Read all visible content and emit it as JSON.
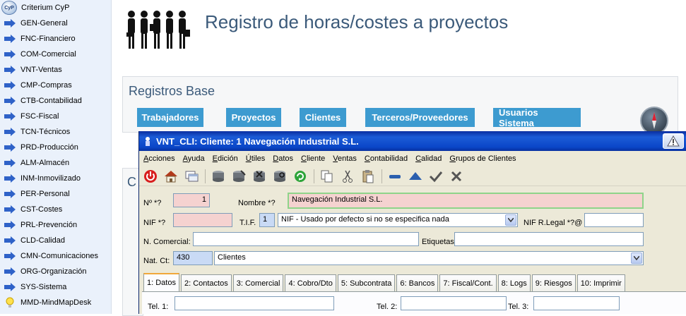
{
  "sidebar": {
    "header": "Criterium CyP",
    "logo_text": "CyP",
    "items": [
      {
        "label": "GEN-General",
        "icon": "arrow-right-icon"
      },
      {
        "label": "FNC-Financiero",
        "icon": "arrow-right-icon"
      },
      {
        "label": "COM-Comercial",
        "icon": "arrow-right-icon"
      },
      {
        "label": "VNT-Ventas",
        "icon": "arrow-right-icon"
      },
      {
        "label": "CMP-Compras",
        "icon": "arrow-right-icon"
      },
      {
        "label": "CTB-Contabilidad",
        "icon": "arrow-right-icon"
      },
      {
        "label": "FSC-Fiscal",
        "icon": "arrow-right-icon"
      },
      {
        "label": "TCN-Técnicos",
        "icon": "arrow-right-icon"
      },
      {
        "label": "PRD-Producción",
        "icon": "arrow-right-icon"
      },
      {
        "label": "ALM-Almacén",
        "icon": "arrow-right-icon"
      },
      {
        "label": "INM-Inmovilizado",
        "icon": "arrow-right-icon"
      },
      {
        "label": "PER-Personal",
        "icon": "arrow-right-icon"
      },
      {
        "label": "CST-Costes",
        "icon": "arrow-right-icon"
      },
      {
        "label": "PRL-Prevención",
        "icon": "arrow-right-icon"
      },
      {
        "label": "CLD-Calidad",
        "icon": "arrow-right-icon"
      },
      {
        "label": "CMN-Comunicaciones",
        "icon": "arrow-right-icon"
      },
      {
        "label": "ORG-Organización",
        "icon": "arrow-right-icon"
      },
      {
        "label": "SYS-Sistema",
        "icon": "arrow-right-icon"
      },
      {
        "label": "MMD-MindMapDesk",
        "icon": "lightbulb-icon"
      }
    ]
  },
  "header": {
    "title": "Registro de horas/costes a proyectos"
  },
  "registros": {
    "title": "Registros Base",
    "buttons": [
      "Trabajadores",
      "Proyectos",
      "Clientes",
      "Terceros/Proveedores",
      "Usuarios Sistema"
    ],
    "second_panel_title": "C"
  },
  "dialog": {
    "title": "VNT_CLI: Cliente: 1 Navegación Industrial S.L.",
    "menu": [
      "Acciones",
      "Ayuda",
      "Edición",
      "Útiles",
      "Datos",
      "Cliente",
      "Ventas",
      "Contabilidad",
      "Calidad",
      "Grupos de Clientes"
    ],
    "toolbar_icons": [
      "power-icon",
      "home-icon",
      "windows-icon",
      "drum-icon",
      "drum-edit-icon",
      "drum-delete-icon",
      "drum-search-icon",
      "refresh-icon",
      "copy-icon",
      "cut-icon",
      "paste-icon",
      "minus-icon",
      "up-triangle-icon",
      "check-icon",
      "close-icon"
    ],
    "form": {
      "num_label": "Nº *?",
      "num_value": "1",
      "nombre_label": "Nombre *?",
      "nombre_value": "Navegación Industrial S.L.",
      "nif_label": "NIF *?",
      "nif_value": "",
      "tif_label": "T.I.F.",
      "tif_value": "1",
      "tif_desc": "NIF - Usado por defecto si no se especifica nada",
      "nif_legal_label": "NIF R.Legal *?@",
      "nif_legal_value": "",
      "ncomercial_label": "N. Comercial:",
      "ncomercial_value": "",
      "etiquetas_label": "Etiquetas",
      "etiquetas_value": "",
      "natct_label": "Nat. Ct:",
      "natct_code": "430",
      "natct_desc": "Clientes"
    },
    "tabs": [
      "1: Datos",
      "2: Contactos",
      "3: Comercial",
      "4: Cobro/Dto",
      "5: Subcontrata",
      "6: Bancos",
      "7: Fiscal/Cont.",
      "8: Logs",
      "9: Riesgos",
      "10: Imprimir"
    ],
    "active_tab": "1: Datos",
    "tel1_label": "Tel. 1:",
    "tel2_label": "Tel. 2:",
    "tel3_label": "Tel. 3:"
  },
  "colors": {
    "accent_button": "#3d9bd0",
    "title_text": "#3b5a7a",
    "required_field": "#f5d2d0",
    "titlebar": "#0a46c8"
  }
}
